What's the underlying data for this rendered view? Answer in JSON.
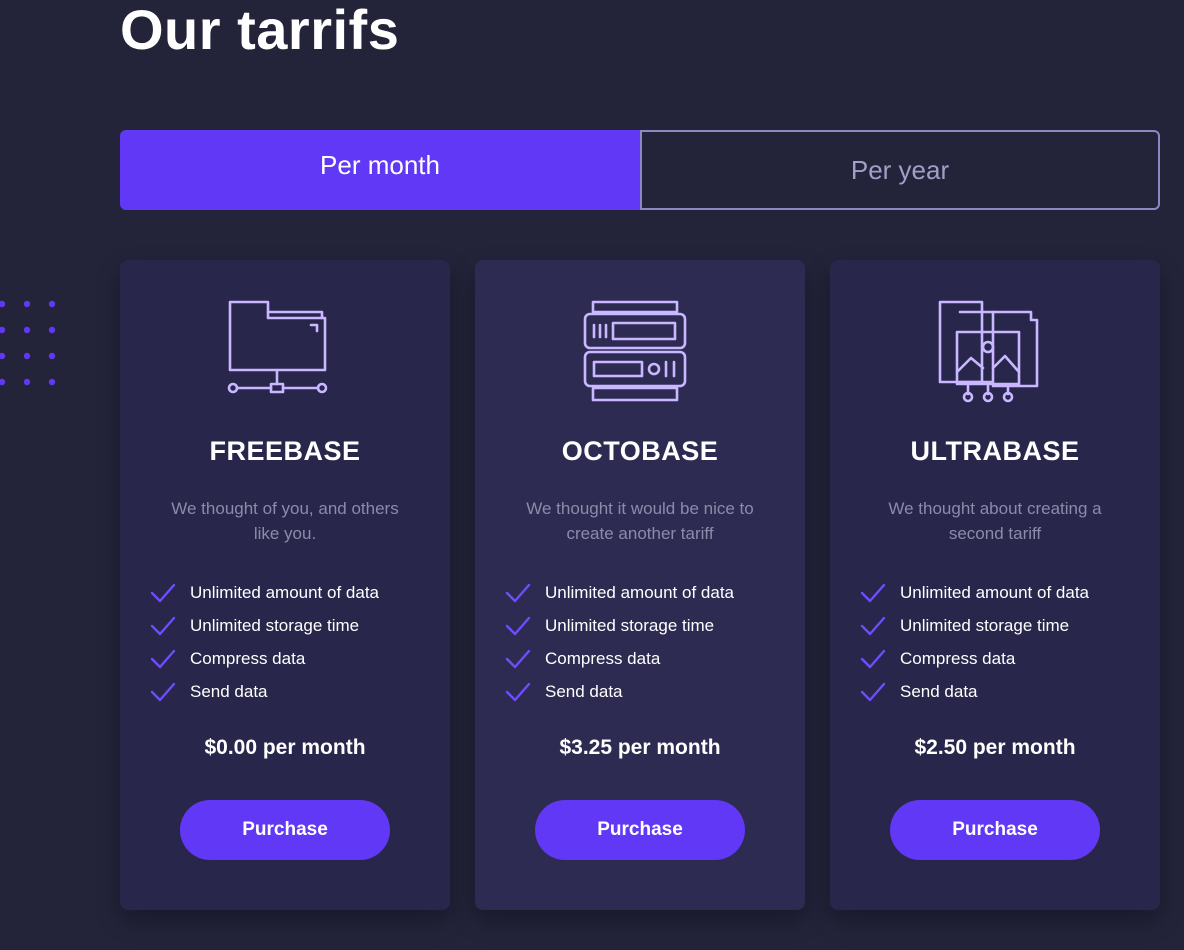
{
  "page": {
    "title": "Our tarrifs"
  },
  "billing_toggle": {
    "options": [
      {
        "label": "Per month",
        "selected": true
      },
      {
        "label": "Per year",
        "selected": false
      }
    ]
  },
  "plans": [
    {
      "name": "FREEBASE",
      "description": "We thought of you, and others like you.",
      "icon": "folder-network-icon",
      "features": [
        "Unlimited amount of data",
        "Unlimited storage time",
        "Compress data",
        "Send data"
      ],
      "price": "$0.00 per month",
      "button_label": "Purchase"
    },
    {
      "name": "OCTOBASE",
      "description": "We thought it would be nice to create another tariff",
      "icon": "server-icon",
      "features": [
        "Unlimited amount of data",
        "Unlimited storage time",
        "Compress data",
        "Send data"
      ],
      "price": "$3.25 per month",
      "button_label": "Purchase"
    },
    {
      "name": "ULTRABASE",
      "description": "We thought about creating a second tariff",
      "icon": "image-folders-icon",
      "features": [
        "Unlimited amount of data",
        "Unlimited storage time",
        "Compress data",
        "Send data"
      ],
      "price": "$2.50 per month",
      "button_label": "Purchase"
    }
  ],
  "colors": {
    "background": "#23233a",
    "card": "#28264a",
    "card_highlight": "#2e2b52",
    "accent": "#6138f5",
    "icon_stroke": "#c9b8ff",
    "muted_text": "#8d8aaa"
  }
}
